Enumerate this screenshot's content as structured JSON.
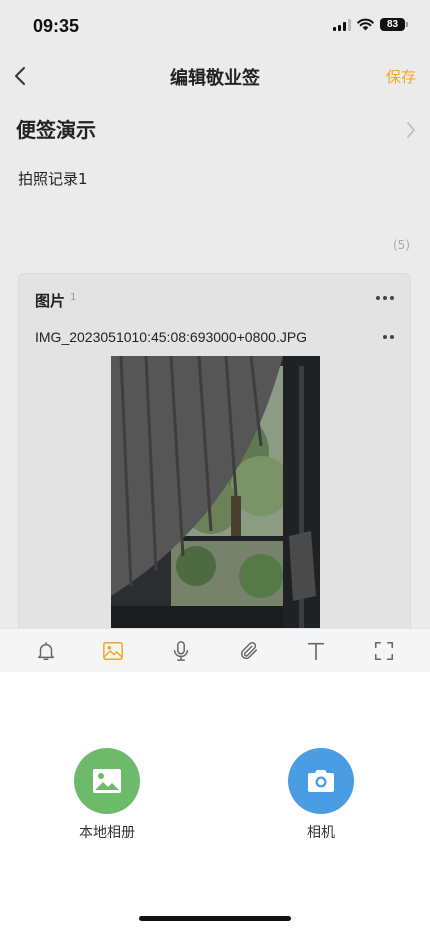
{
  "status_bar": {
    "time": "09:35",
    "battery": "83"
  },
  "nav": {
    "title": "编辑敬业签",
    "save_label": "保存",
    "back_icon": "chevron-left-icon"
  },
  "note": {
    "title": "便签演示",
    "body": "拍照记录1",
    "char_count": "(5)"
  },
  "attachment": {
    "header": "图片",
    "count": "1",
    "file_name": "IMG_2023051010:45:08:693000+0800.JPG"
  },
  "toolbar": {
    "items": [
      {
        "icon": "bell-icon"
      },
      {
        "icon": "image-icon",
        "active": true
      },
      {
        "icon": "microphone-icon"
      },
      {
        "icon": "paperclip-icon"
      },
      {
        "icon": "text-icon"
      },
      {
        "icon": "fullscreen-icon"
      }
    ]
  },
  "picker": {
    "album": {
      "label": "本地相册",
      "color": "#6dbb6a"
    },
    "camera": {
      "label": "相机",
      "color": "#4a9de2"
    }
  },
  "colors": {
    "accent": "#f5a623",
    "background": "#ebebeb"
  }
}
